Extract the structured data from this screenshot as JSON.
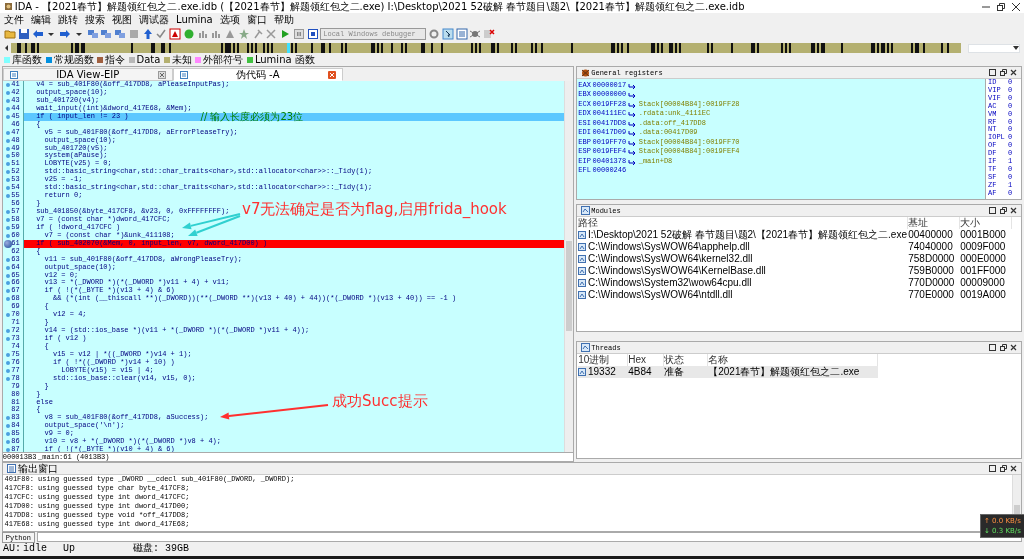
{
  "window": {
    "title": "IDA - 【2021春节】解题领红包之二.exe.idb (【2021春节】解题领红包之二.exe) I:\\Desktop\\2021 52破解 春节题目\\题2\\【2021春节】解题领红包之二.exe.idb"
  },
  "menu": [
    "文件",
    "编辑",
    "跳转",
    "搜索",
    "视图",
    "调试器",
    "Lumina",
    "选项",
    "窗口",
    "帮助"
  ],
  "toolbar": {
    "debugger": "Local Windows debugger"
  },
  "legend": [
    {
      "label": "库函数",
      "color": "#80ffff"
    },
    {
      "label": "常规函数",
      "color": "#0090e0"
    },
    {
      "label": "指令",
      "color": "#a06040"
    },
    {
      "label": "Data",
      "color": "#b8b8b8"
    },
    {
      "label": "未知",
      "color": "#b4b070"
    },
    {
      "label": "外部符号",
      "color": "#ff88ff"
    },
    {
      "label": "Lumina 函数",
      "color": "#40c040"
    }
  ],
  "tabs": [
    {
      "label": "IDA View-EIP",
      "selected": false
    },
    {
      "label": "伪代码 -A",
      "selected": true
    }
  ],
  "code": [
    {
      "no": "41",
      "text": "  v4 = sub_401F80(&off_417DD8, aPleaseInputPas);",
      "dot": true,
      "kind": "normal"
    },
    {
      "no": "42",
      "text": "  output_space(10);",
      "dot": true,
      "kind": "normal"
    },
    {
      "no": "43",
      "text": "  sub_401720(v4);",
      "dot": true,
      "kind": "normal"
    },
    {
      "no": "44",
      "text": "  wait_input((int)&dword_417E68, &Mem);",
      "dot": true,
      "kind": "normal"
    },
    {
      "no": "45",
      "text": "  if ( input_len != 23 )",
      "comment": "// 输入长度必须为23位",
      "dot": true,
      "kind": "current"
    },
    {
      "no": "46",
      "text": "  {",
      "dot": false,
      "kind": "normal"
    },
    {
      "no": "47",
      "text": "    v5 = sub_401F80(&off_417DD8, aErrorPleaseTry);",
      "dot": true,
      "kind": "normal"
    },
    {
      "no": "48",
      "text": "    output_space(10);",
      "dot": true,
      "kind": "normal"
    },
    {
      "no": "49",
      "text": "    sub_401720(v5);",
      "dot": true,
      "kind": "normal"
    },
    {
      "no": "50",
      "text": "    system(aPause);",
      "dot": true,
      "kind": "normal"
    },
    {
      "no": "51",
      "text": "    LOBYTE(v25) = 0;",
      "dot": true,
      "kind": "normal"
    },
    {
      "no": "52",
      "text": "    std::basic_string<char,std::char_traits<char>,std::allocator<char>>::_Tidy(1);",
      "dot": true,
      "kind": "normal"
    },
    {
      "no": "53",
      "text": "    v25 = -1;",
      "dot": true,
      "kind": "normal"
    },
    {
      "no": "54",
      "text": "    std::basic_string<char,std::char_traits<char>,std::allocator<char>>::_Tidy(1);",
      "dot": true,
      "kind": "normal"
    },
    {
      "no": "55",
      "text": "    return 0;",
      "dot": true,
      "kind": "normal"
    },
    {
      "no": "56",
      "text": "  }",
      "dot": false,
      "kind": "normal"
    },
    {
      "no": "57",
      "text": "  sub_401850(&byte_417CF8, &v23, 0, 0xFFFFFFFF);",
      "dot": true,
      "kind": "normal"
    },
    {
      "no": "58",
      "text": "  v7 = (const char *)dword_417CFC;",
      "dot": true,
      "kind": "normal"
    },
    {
      "no": "59",
      "text": "  if ( !dword_417CFC )",
      "dot": true,
      "kind": "normal"
    },
    {
      "no": "60",
      "text": "    v7 = (const char *)&unk_411108;",
      "dot": true,
      "kind": "normal"
    },
    {
      "no": "61",
      "text": "  if ( sub_402070(&Mem, 0, input_len, v7, dword_417D00) )",
      "dot": true,
      "kind": "breakpoint"
    },
    {
      "no": "62",
      "text": "  {",
      "dot": false,
      "kind": "normal"
    },
    {
      "no": "63",
      "text": "    v11 = sub_401F80(&off_417DD8, aWrongPleaseTry);",
      "dot": true,
      "kind": "normal"
    },
    {
      "no": "64",
      "text": "    output_space(10);",
      "dot": true,
      "kind": "normal"
    },
    {
      "no": "65",
      "text": "    v12 = 0;",
      "dot": true,
      "kind": "normal"
    },
    {
      "no": "66",
      "text": "    v13 = *(_DWORD *)(*(_DWORD *)v11 + 4) + v11;",
      "dot": true,
      "kind": "normal"
    },
    {
      "no": "67",
      "text": "    if ( !(*(_BYTE *)(v13 + 4) & 6)",
      "dot": true,
      "kind": "normal"
    },
    {
      "no": "68",
      "text": "      && (*(int (__thiscall **)(_DWORD))(**(_DWORD **)(v13 + 40) + 44))(*(_DWORD *)(v13 + 40)) == -1 )",
      "dot": true,
      "kind": "normal"
    },
    {
      "no": "69",
      "text": "    {",
      "dot": false,
      "kind": "normal"
    },
    {
      "no": "70",
      "text": "      v12 = 4;",
      "dot": true,
      "kind": "normal"
    },
    {
      "no": "71",
      "text": "    }",
      "dot": false,
      "kind": "normal"
    },
    {
      "no": "72",
      "text": "    v14 = (std::ios_base *)(v11 + *(_DWORD *)(*(_DWORD *)v11 + 4));",
      "dot": true,
      "kind": "normal"
    },
    {
      "no": "73",
      "text": "    if ( v12 )",
      "dot": true,
      "kind": "normal"
    },
    {
      "no": "74",
      "text": "    {",
      "dot": false,
      "kind": "normal"
    },
    {
      "no": "75",
      "text": "      v15 = v12 | *((_DWORD *)v14 + 1);",
      "dot": true,
      "kind": "normal"
    },
    {
      "no": "76",
      "text": "      if ( !*((_DWORD *)v14 + 10) )",
      "dot": true,
      "kind": "normal"
    },
    {
      "no": "77",
      "text": "        LOBYTE(v15) = v15 | 4;",
      "dot": true,
      "kind": "normal"
    },
    {
      "no": "78",
      "text": "      std::ios_base::clear(v14, v15, 0);",
      "dot": true,
      "kind": "normal"
    },
    {
      "no": "79",
      "text": "    }",
      "dot": false,
      "kind": "normal"
    },
    {
      "no": "80",
      "text": "  }",
      "dot": false,
      "kind": "normal"
    },
    {
      "no": "81",
      "text": "  else",
      "dot": false,
      "kind": "normal"
    },
    {
      "no": "82",
      "text": "  {",
      "dot": false,
      "kind": "normal"
    },
    {
      "no": "83",
      "text": "    v8 = sub_401F80(&off_417DD8, aSuccess);",
      "dot": true,
      "kind": "normal"
    },
    {
      "no": "84",
      "text": "    output_space('\\n');",
      "dot": true,
      "kind": "normal"
    },
    {
      "no": "85",
      "text": "    v9 = 0;",
      "dot": true,
      "kind": "normal"
    },
    {
      "no": "86",
      "text": "    v10 = v8 + *(_DWORD *)(*(_DWORD *)v8 + 4);",
      "dot": true,
      "kind": "normal"
    },
    {
      "no": "87",
      "text": "    if ( !(*(_BYTE *)(v10 + 4) & 6)",
      "dot": true,
      "kind": "normal"
    }
  ],
  "code_status": {
    "address": "000013B3",
    "location": "_main:61 (4013B3)"
  },
  "annotations": [
    {
      "text": "v7无法确定是否为flag,启用frida_hook",
      "color": "#ff3030"
    },
    {
      "text": "成功Succ提示",
      "color": "#ff3030"
    }
  ],
  "registers": {
    "title": "General registers",
    "rows": [
      {
        "name": "EAX",
        "value": "00000017",
        "arrow": true
      },
      {
        "name": "EBX",
        "value": "00000000",
        "arrow": true
      },
      {
        "name": "ECX",
        "value": "0019FF28",
        "arrow": true,
        "ref": "Stack[00004B84]:0019FF28"
      },
      {
        "name": "EDX",
        "value": "004111EC",
        "arrow": true,
        "ref": ".rdata:unk_4111EC"
      },
      {
        "name": "ESI",
        "value": "00417DD8",
        "arrow": true,
        "ref": ".data:off_417DD8"
      },
      {
        "name": "EDI",
        "value": "00417D09",
        "arrow": true,
        "ref": ".data:00417D09"
      },
      {
        "name": "EBP",
        "value": "0019FF70",
        "arrow": true,
        "ref": "Stack[00004B84]:0019FF70"
      },
      {
        "name": "ESP",
        "value": "0019FEF4",
        "arrow": true,
        "ref": "Stack[00004B84]:0019FEF4"
      },
      {
        "name": "EIP",
        "value": "00401378",
        "arrow": true,
        "ref": "_main+D8"
      },
      {
        "name": "EFL",
        "value": "00000246",
        "arrow": false
      }
    ],
    "flags": [
      {
        "name": "ID",
        "value": "0"
      },
      {
        "name": "VIP",
        "value": "0"
      },
      {
        "name": "VIF",
        "value": "0"
      },
      {
        "name": "AC",
        "value": "0"
      },
      {
        "name": "VM",
        "value": "0"
      },
      {
        "name": "RF",
        "value": "0"
      },
      {
        "name": "NT",
        "value": "0"
      },
      {
        "name": "IOPL",
        "value": "0"
      },
      {
        "name": "OF",
        "value": "0"
      },
      {
        "name": "DF",
        "value": "0"
      },
      {
        "name": "IF",
        "value": "1"
      },
      {
        "name": "TF",
        "value": "0"
      },
      {
        "name": "SF",
        "value": "0"
      },
      {
        "name": "ZF",
        "value": "1"
      },
      {
        "name": "AF",
        "value": "0"
      }
    ]
  },
  "modules": {
    "title": "Modules",
    "columns": [
      "路径",
      "基址",
      "大小"
    ],
    "rows": [
      [
        "I:\\Desktop\\2021 52破解 春节题目\\题2\\【2021春节】解题领红包之二.exe",
        "00400000",
        "0001B000"
      ],
      [
        "C:\\Windows\\SysWOW64\\apphelp.dll",
        "74040000",
        "0009F000"
      ],
      [
        "C:\\Windows\\SysWOW64\\kernel32.dll",
        "758D0000",
        "000E0000"
      ],
      [
        "C:\\Windows\\SysWOW64\\KernelBase.dll",
        "759B0000",
        "001FF000"
      ],
      [
        "C:\\Windows\\System32\\wow64cpu.dll",
        "770D0000",
        "00009000"
      ],
      [
        "C:\\Windows\\SysWOW64\\ntdll.dll",
        "770E0000",
        "0019A000"
      ]
    ]
  },
  "threads": {
    "title": "Threads",
    "columns": [
      "10进制",
      "Hex",
      "状态",
      "名称"
    ],
    "rows": [
      {
        "cells": [
          "19332",
          "4B84",
          "准备",
          "【2021春节】解题领红包之二.exe"
        ],
        "selected": true
      }
    ]
  },
  "output": {
    "title": "输出窗口",
    "lines": [
      "401F80: using guessed type _DWORD __cdecl sub_401F80(_DWORD, _DWORD);",
      "417CF8: using guessed type char byte_417CF8;",
      "417CFC: using guessed type int dword_417CFC;",
      "417D00: using guessed type int dword_417D00;",
      "417DD8: using guessed type void *off_417DD8;",
      "417E68: using guessed type int dword_417E68;"
    ]
  },
  "python_button": "Python",
  "status_bar": [
    "AU:",
    "idle",
    "Up",
    "磁盘: 39GB"
  ],
  "network": {
    "up": "↑ 0.0 KB/s",
    "down": "↓ 0.3 KB/s"
  }
}
